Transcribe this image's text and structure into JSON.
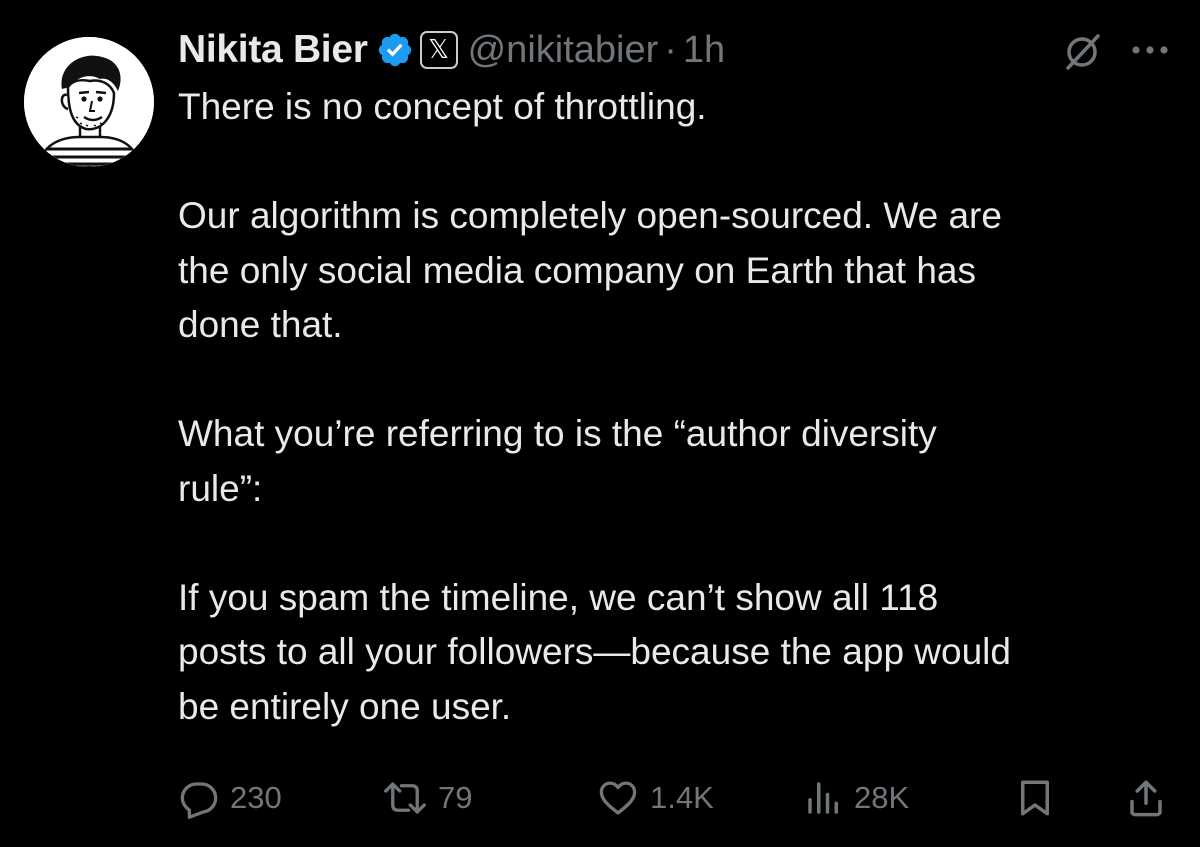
{
  "author": {
    "name": "Nikita Bier",
    "handle": "@nikitabier",
    "separator": "·",
    "time": "1h",
    "x_badge": "𝕏"
  },
  "icons": {
    "verified": "verified-badge-icon",
    "grok": "grok-icon",
    "more": "more-icon",
    "reply": "reply-icon",
    "repost": "repost-icon",
    "like": "like-icon",
    "views": "views-icon",
    "bookmark": "bookmark-icon",
    "share": "share-icon"
  },
  "colors": {
    "background": "#000000",
    "text": "#e7e9ea",
    "muted": "#71767b",
    "verified": "#1d9bf0"
  },
  "tweet": {
    "paragraphs": [
      "There is no concept of throttling.",
      "Our algorithm is completely open-sourced. We are\nthe only social media company on Earth that has\ndone that.",
      "What you’re referring to is the “author diversity\nrule”:",
      "If you spam the timeline, we can’t show all 118\nposts to all your followers—because the app would\nbe entirely one user."
    ]
  },
  "metrics": {
    "replies": "230",
    "reposts": "79",
    "likes": "1.4K",
    "views": "28K"
  }
}
